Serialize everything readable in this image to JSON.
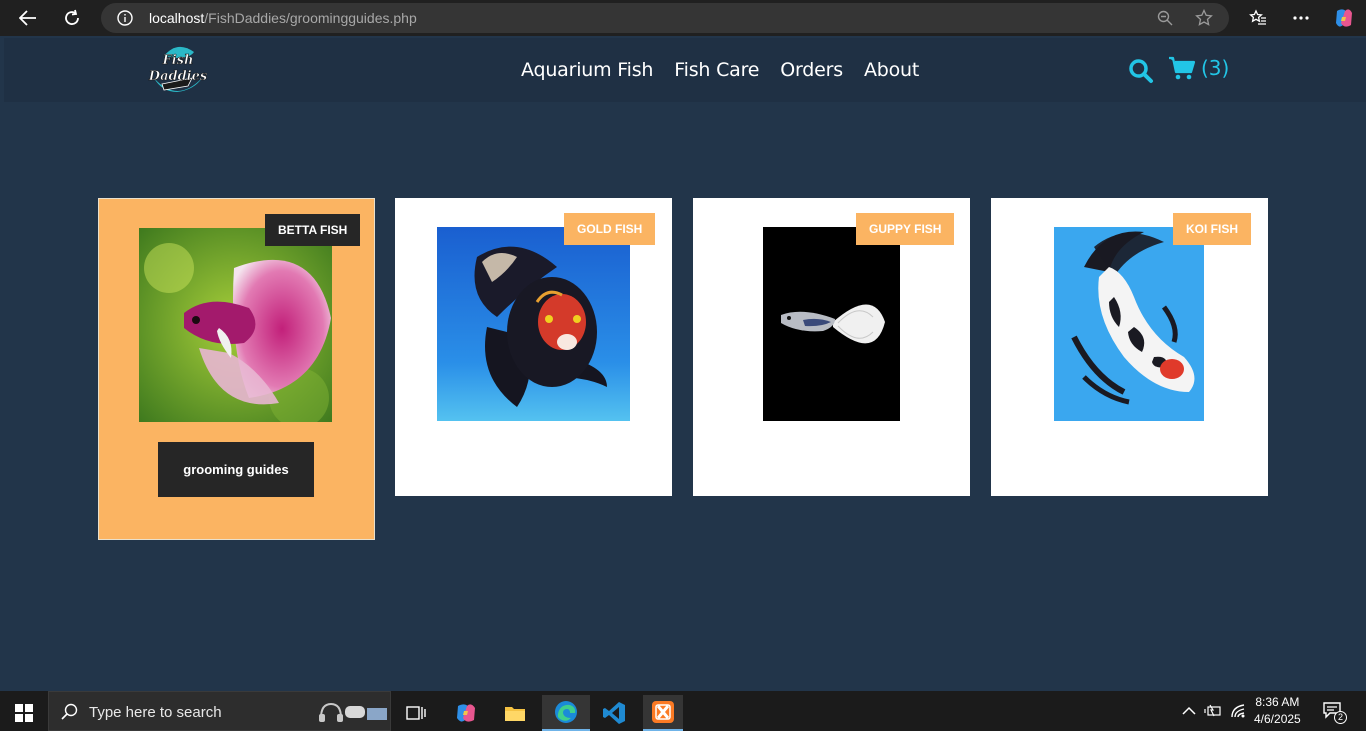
{
  "browser": {
    "url_host": "localhost",
    "url_path": "/FishDaddies/groomingguides.php"
  },
  "site": {
    "logo_text": "Fish Daddies",
    "nav": [
      "Aquarium Fish",
      "Fish Care",
      "Orders",
      "About"
    ],
    "cart_count": "(3)",
    "accent_color": "#22c5e6"
  },
  "cards": [
    {
      "badge": "BETTA FISH",
      "button": "grooming guides",
      "active": true
    },
    {
      "badge": "GOLD FISH"
    },
    {
      "badge": "GUPPY FISH"
    },
    {
      "badge": "KOI FISH"
    }
  ],
  "taskbar": {
    "search_placeholder": "Type here to search",
    "time": "8:36 AM",
    "date": "4/6/2025",
    "notification_count": "2"
  }
}
